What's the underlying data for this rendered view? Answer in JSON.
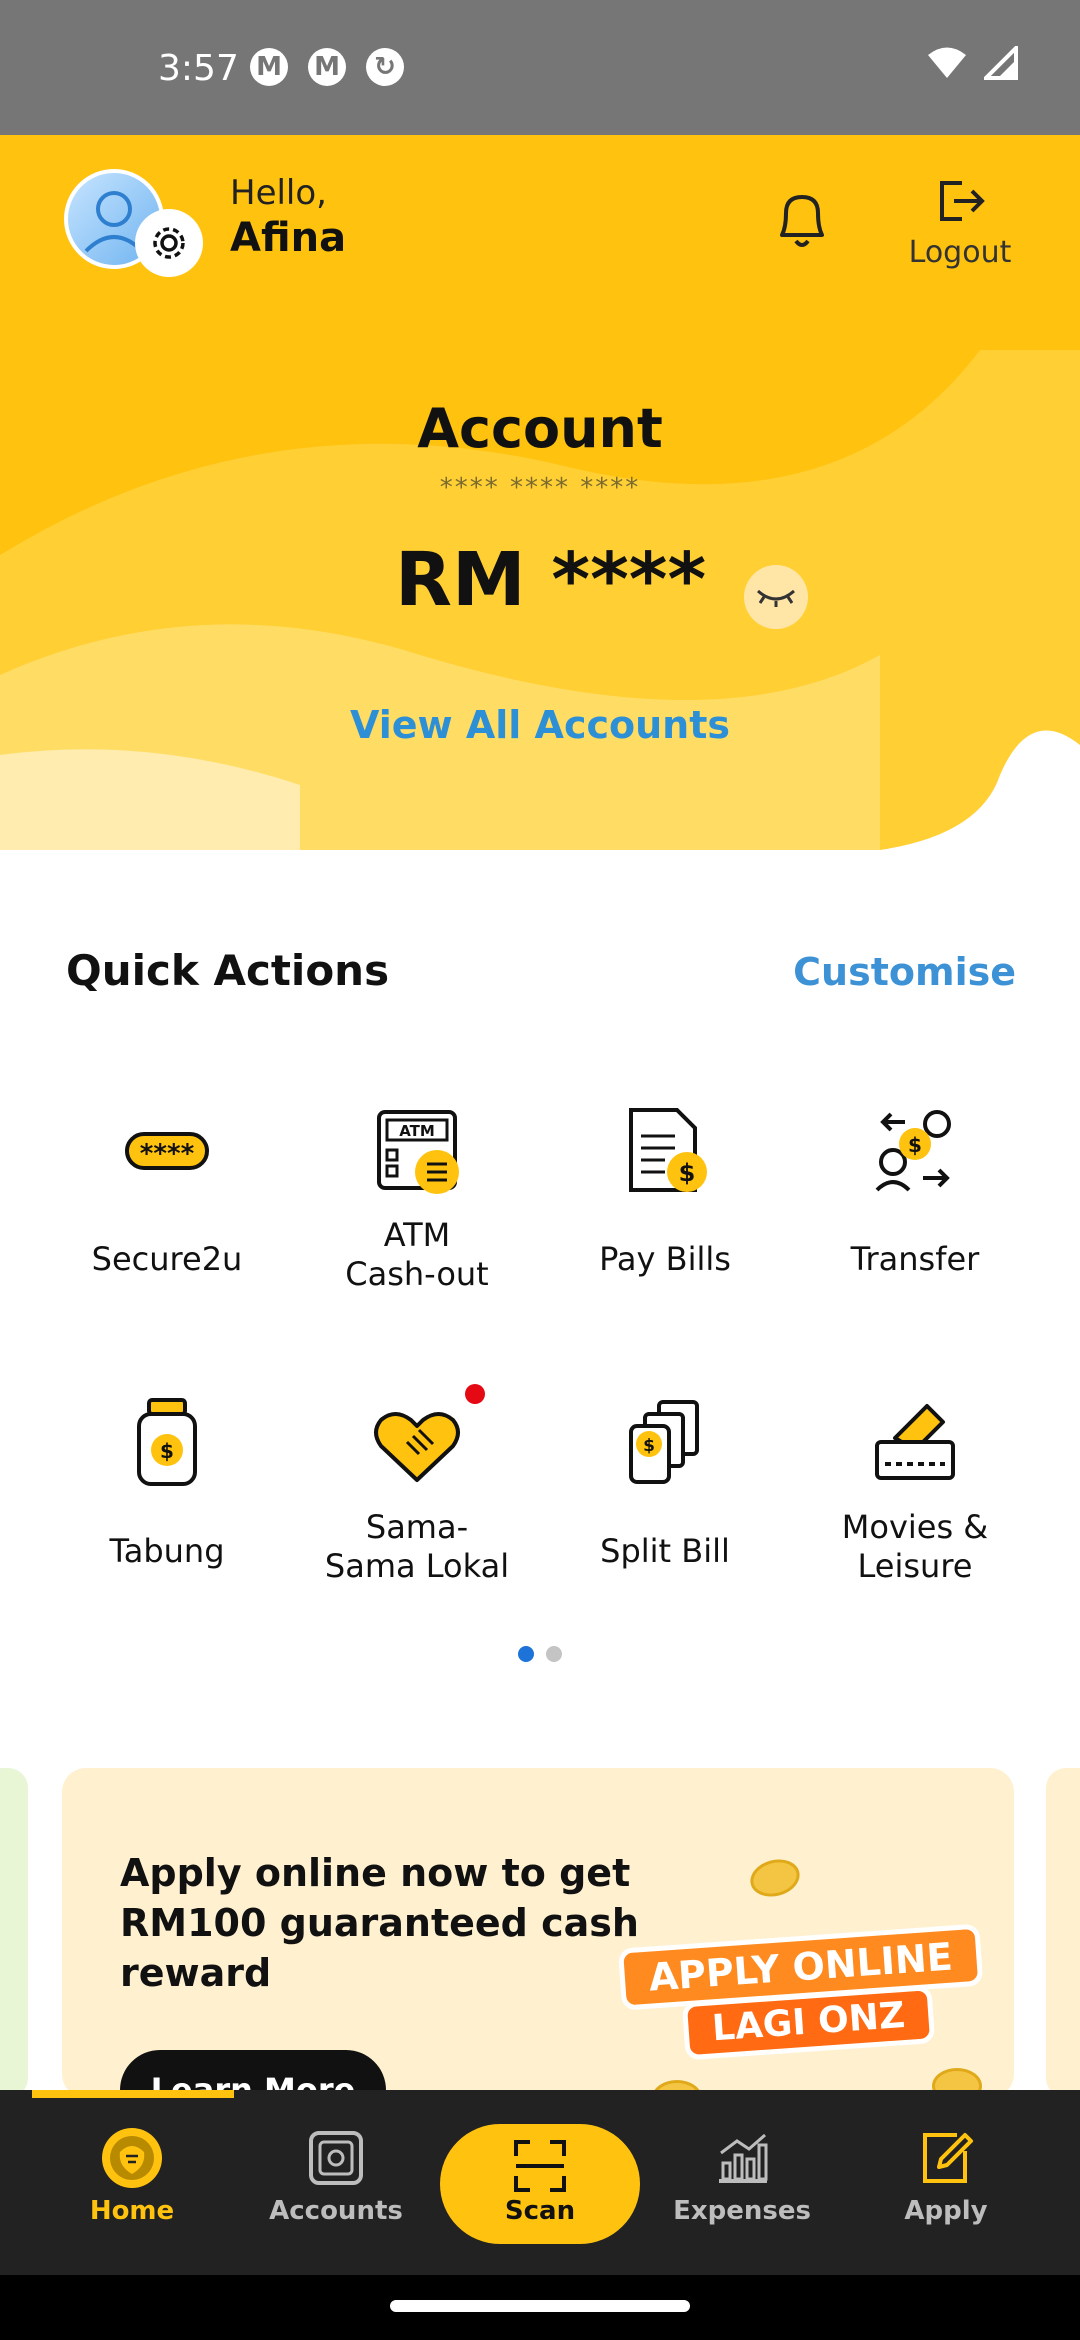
{
  "status_bar": {
    "time": "3:57",
    "notification_icons": [
      "M",
      "M",
      "↻"
    ],
    "right_icons": [
      "wifi-icon",
      "signal-icon"
    ]
  },
  "header": {
    "greeting": "Hello,",
    "user_name": "Afina",
    "logout_label": "Logout",
    "account_title": "Account",
    "account_number_masked": "**** **** ****",
    "balance_masked": "RM ****",
    "view_all_label": "View All Accounts",
    "colors": {
      "primary": "#ffc20e",
      "link": "#2d8fd6"
    }
  },
  "quick_actions": {
    "title": "Quick Actions",
    "customise_label": "Customise",
    "items": [
      {
        "label": "Secure2u",
        "icon": "secure2u-icon"
      },
      {
        "label": "ATM\nCash-out",
        "icon": "atm-cashout-icon"
      },
      {
        "label": "Pay Bills",
        "icon": "pay-bills-icon"
      },
      {
        "label": "Transfer",
        "icon": "transfer-icon"
      },
      {
        "label": "Tabung",
        "icon": "tabung-jar-icon"
      },
      {
        "label": "Sama-\nSama Lokal",
        "icon": "handshake-icon",
        "has_notification": true
      },
      {
        "label": "Split Bill",
        "icon": "split-bill-icon"
      },
      {
        "label": "Movies &\nLeisure",
        "icon": "movie-ticket-icon"
      }
    ],
    "page_indicator": {
      "pages": 2,
      "active": 1
    }
  },
  "banner": {
    "headline": "Apply online now to get RM100 guaranteed cash reward",
    "button_label": "Learn More",
    "badge_line1": "APPLY ONLINE",
    "badge_line2": "LAGI ONZ"
  },
  "bottom_nav": {
    "items": [
      {
        "label": "Home",
        "icon": "tiger-logo-icon",
        "active": true
      },
      {
        "label": "Accounts",
        "icon": "safe-icon"
      },
      {
        "label": "Scan",
        "icon": "scan-icon"
      },
      {
        "label": "Expenses",
        "icon": "chart-icon"
      },
      {
        "label": "Apply",
        "icon": "edit-form-icon"
      }
    ]
  }
}
